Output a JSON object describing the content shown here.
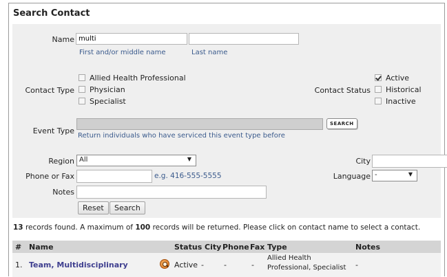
{
  "title": "Search Contact",
  "form": {
    "name_label": "Name",
    "first_name_value": "multi",
    "last_name_value": "",
    "first_name_hint": "First and/or middle name",
    "last_name_hint": "Last name",
    "contact_type_label": "Contact Type",
    "contact_types": [
      {
        "label": "Allied Health Professional",
        "checked": false
      },
      {
        "label": "Physician",
        "checked": false
      },
      {
        "label": "Specialist",
        "checked": false
      }
    ],
    "contact_status_label": "Contact Status",
    "contact_statuses": [
      {
        "label": "Active",
        "checked": true
      },
      {
        "label": "Historical",
        "checked": false
      },
      {
        "label": "Inactive",
        "checked": false
      }
    ],
    "event_type_label": "Event Type",
    "event_type_hint": "Return individuals who have serviced this event type before",
    "event_search_button": "SEARCH",
    "region_label": "Region",
    "region_value": "All",
    "city_label": "City",
    "city_value": "",
    "phone_label": "Phone or Fax",
    "phone_value": "",
    "phone_hint": "e.g. 416-555-5555",
    "language_label": "Language",
    "language_value": "-",
    "notes_label": "Notes",
    "notes_value": "",
    "reset_button": "Reset",
    "search_button": "Search"
  },
  "results": {
    "count": "13",
    "text1": " records found. A maximum of ",
    "max": "100",
    "text2": " records will be returned. Please click on contact name to select a contact."
  },
  "table": {
    "headers": {
      "num": "#",
      "name": "Name",
      "status": "Status",
      "city": "City",
      "phone": "Phone",
      "fax": "Fax",
      "type": "Type",
      "notes": "Notes"
    },
    "rows": [
      {
        "num": "1.",
        "name": "Team, Multidisciplinary",
        "status": "Active",
        "city": "-",
        "phone": "-",
        "fax": "-",
        "type_line1": "Allied Health",
        "type_line2": "Professional, Specialist",
        "notes": "-"
      }
    ]
  },
  "colors": {
    "link": "#3f3f8f",
    "hint": "#3a5a8c",
    "panel_bg": "#efefef",
    "header_bg": "#d4d4d4"
  }
}
